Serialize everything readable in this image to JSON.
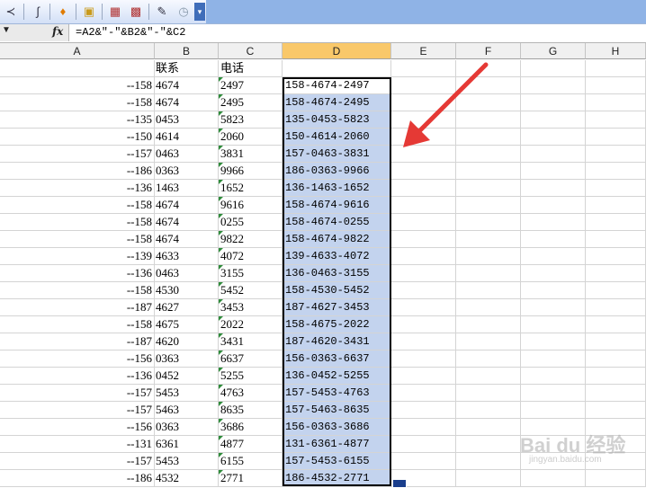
{
  "toolbar": {
    "icons": [
      "share-icon",
      "insert-function-icon",
      "warning-icon",
      "folder-icon",
      "table-icon",
      "chart-icon",
      "drawing-icon",
      "clock-icon",
      "more-icon"
    ]
  },
  "formula_bar": {
    "fx_label": "fx",
    "formula": "=A2&\"-\"&B2&\"-\"&C2"
  },
  "columns": [
    "A",
    "B",
    "C",
    "D",
    "E",
    "F",
    "G",
    "H"
  ],
  "selected_column": "D",
  "header_row": {
    "B": "联系",
    "C": "电话"
  },
  "rows": [
    {
      "a": "--158",
      "b": "4674",
      "c": "2497",
      "d": "158-4674-2497"
    },
    {
      "a": "--158",
      "b": "4674",
      "c": "2495",
      "d": "158-4674-2495"
    },
    {
      "a": "--135",
      "b": "0453",
      "c": "5823",
      "d": "135-0453-5823"
    },
    {
      "a": "--150",
      "b": "4614",
      "c": "2060",
      "d": "150-4614-2060"
    },
    {
      "a": "--157",
      "b": "0463",
      "c": "3831",
      "d": "157-0463-3831"
    },
    {
      "a": "--186",
      "b": "0363",
      "c": "9966",
      "d": "186-0363-9966"
    },
    {
      "a": "--136",
      "b": "1463",
      "c": "1652",
      "d": "136-1463-1652"
    },
    {
      "a": "--158",
      "b": "4674",
      "c": "9616",
      "d": "158-4674-9616"
    },
    {
      "a": "--158",
      "b": "4674",
      "c": "0255",
      "d": "158-4674-0255"
    },
    {
      "a": "--158",
      "b": "4674",
      "c": "9822",
      "d": "158-4674-9822"
    },
    {
      "a": "--139",
      "b": "4633",
      "c": "4072",
      "d": "139-4633-4072"
    },
    {
      "a": "--136",
      "b": "0463",
      "c": "3155",
      "d": "136-0463-3155"
    },
    {
      "a": "--158",
      "b": "4530",
      "c": "5452",
      "d": "158-4530-5452"
    },
    {
      "a": "--187",
      "b": "4627",
      "c": "3453",
      "d": "187-4627-3453"
    },
    {
      "a": "--158",
      "b": "4675",
      "c": "2022",
      "d": "158-4675-2022"
    },
    {
      "a": "--187",
      "b": "4620",
      "c": "3431",
      "d": "187-4620-3431"
    },
    {
      "a": "--156",
      "b": "0363",
      "c": "6637",
      "d": "156-0363-6637"
    },
    {
      "a": "--136",
      "b": "0452",
      "c": "5255",
      "d": "136-0452-5255"
    },
    {
      "a": "--157",
      "b": "5453",
      "c": "4763",
      "d": "157-5453-4763"
    },
    {
      "a": "--157",
      "b": "5463",
      "c": "8635",
      "d": "157-5463-8635"
    },
    {
      "a": "--156",
      "b": "0363",
      "c": "3686",
      "d": "156-0363-3686"
    },
    {
      "a": "--131",
      "b": "6361",
      "c": "4877",
      "d": "131-6361-4877"
    },
    {
      "a": "--157",
      "b": "5453",
      "c": "6155",
      "d": "157-5453-6155"
    },
    {
      "a": "--186",
      "b": "4532",
      "c": "2771",
      "d": "186-4532-2771"
    }
  ],
  "watermark": {
    "text": "Bai du 经验",
    "sub": "jingyan.baidu.com"
  },
  "colors": {
    "selection": "#c3d3ee",
    "selected_header": "#f9c86a",
    "arrow": "#e53935"
  }
}
